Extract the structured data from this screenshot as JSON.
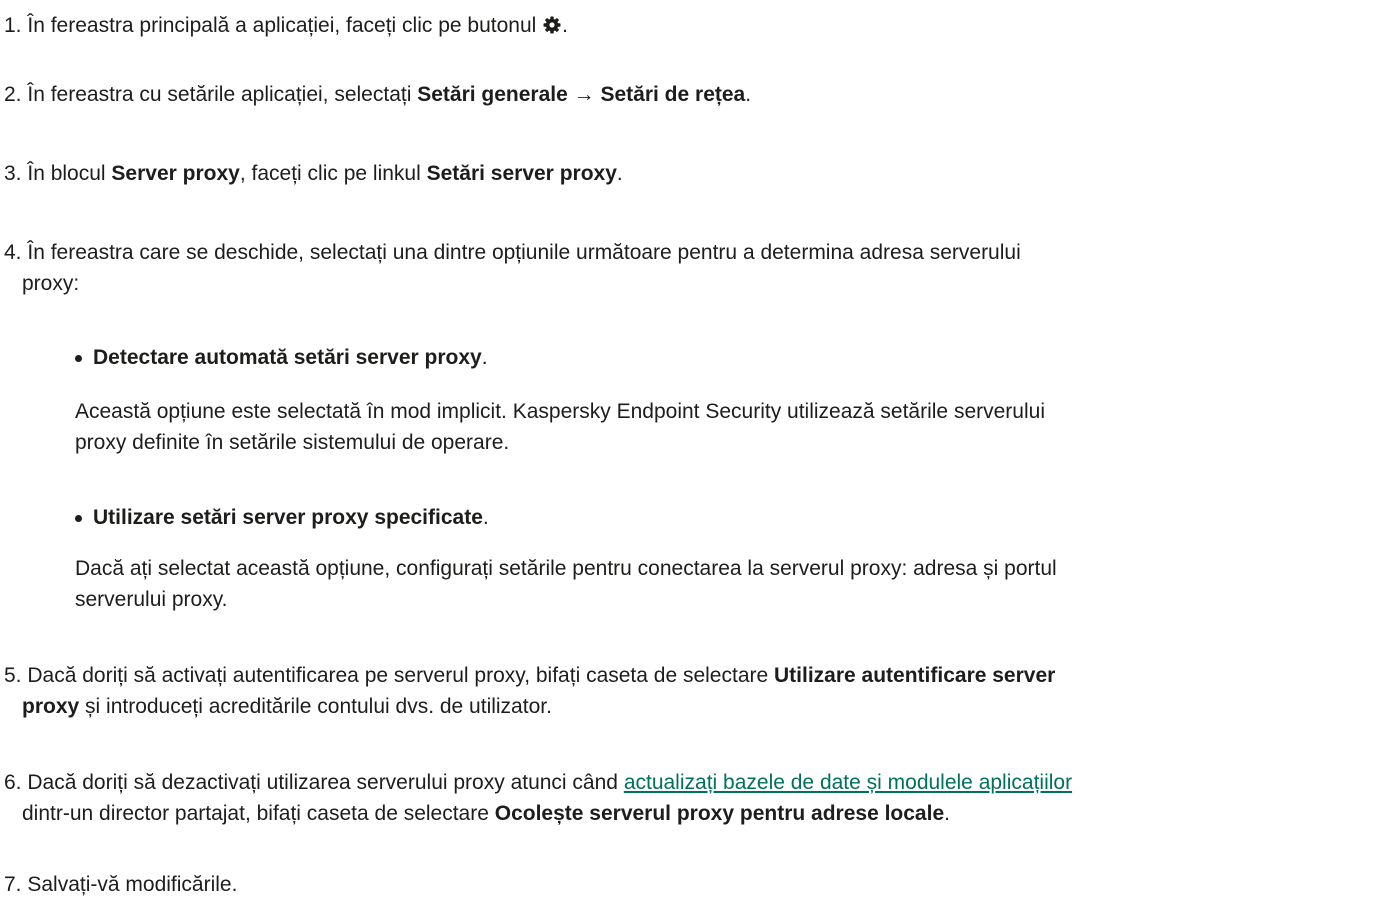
{
  "steps": [
    {
      "num": "1.",
      "pre": "În fereastra principală a aplicației, faceți clic pe butonul",
      "icon": "gear-icon",
      "post": "."
    },
    {
      "num": "2.",
      "pre": "În fereastra cu setările aplicației, selectați ",
      "bold1": "Setări generale",
      "arrow": " → ",
      "bold2": "Setări de rețea",
      "post": "."
    },
    {
      "num": "3.",
      "pre": "În blocul ",
      "bold1": "Server proxy",
      "mid": ", faceți clic pe linkul ",
      "bold2": "Setări server proxy",
      "post": "."
    },
    {
      "num": "4.",
      "line1": "În fereastra care se deschide, selectați una dintre opțiunile următoare pentru a determina adresa serverului",
      "line2": "proxy:"
    },
    {
      "num": "5.",
      "pre": "Dacă doriți să activați autentificarea pe serverul proxy, bifați caseta de selectare ",
      "bold1a": "Utilizare autentificare server",
      "bold1b": "proxy",
      "post": " și introduceți acreditările contului dvs. de utilizator."
    },
    {
      "num": "6.",
      "pre": "Dacă doriți să dezactivați utilizarea serverului proxy atunci când ",
      "link": "actualizați bazele de date și modulele aplicațiilor",
      "line2pre": "dintr-un director partajat, bifați caseta de selectare ",
      "bold1": "Ocolește serverul proxy pentru adrese locale",
      "post": "."
    },
    {
      "num": "7.",
      "text": "Salvați-vă modificările."
    }
  ],
  "options": [
    {
      "title": "Detectare automată setări server proxy",
      "post": ".",
      "desc1": "Această opțiune este selectată în mod implicit. Kaspersky Endpoint Security utilizează setările serverului",
      "desc2": "proxy definite în setările sistemului de operare."
    },
    {
      "title": "Utilizare setări server proxy specificate",
      "post": ".",
      "desc1": "Dacă ați selectat această opțiune, configurați setările pentru conectarea la serverul proxy: adresa și portul",
      "desc2": "serverului proxy."
    }
  ],
  "colors": {
    "text": "#1d1d1b",
    "link": "#00715d"
  }
}
